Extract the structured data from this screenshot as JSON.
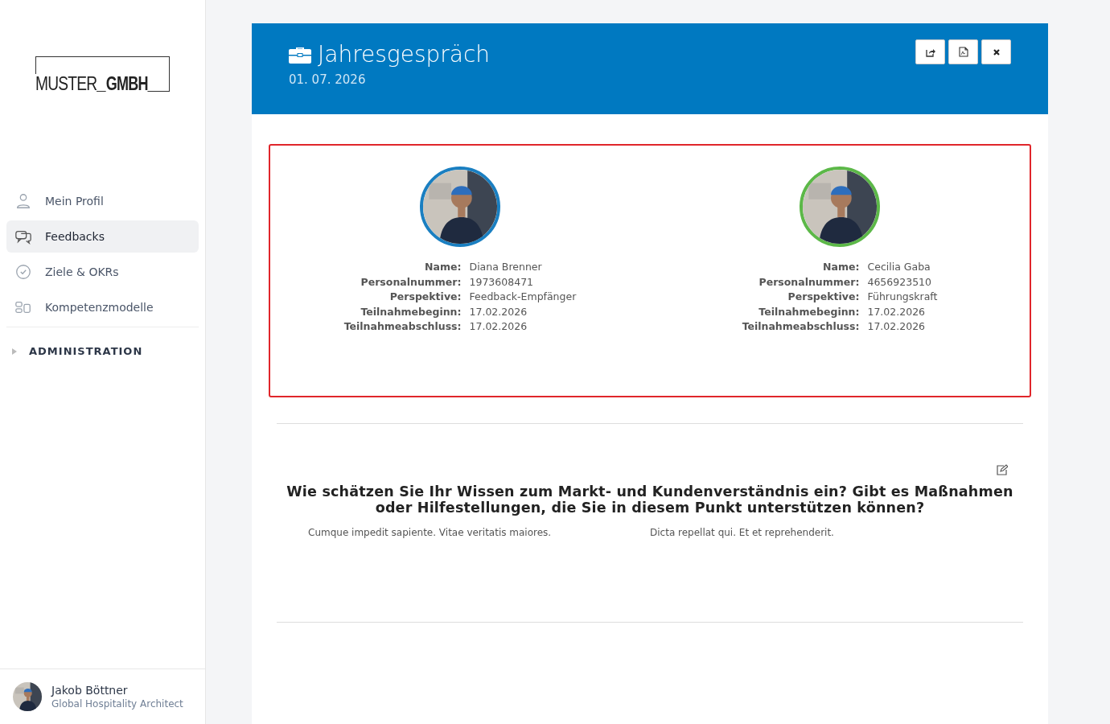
{
  "logo": {
    "light": "MUSTER",
    "bold": "GMBH"
  },
  "nav": [
    {
      "label": "Mein Profil",
      "kind": "person",
      "selected": false
    },
    {
      "label": "Feedbacks",
      "kind": "chat",
      "selected": true
    },
    {
      "label": "Ziele & OKRs",
      "kind": "check",
      "selected": false
    },
    {
      "label": "Kompetenzmodelle",
      "kind": "grid",
      "selected": false
    }
  ],
  "admin_section": {
    "label": "ADMINISTRATION",
    "expanded": false
  },
  "user": {
    "name": "Jakob Böttner",
    "role": "Global Hospitality Architect"
  },
  "header": {
    "title": "Jahresgespräch",
    "date": "01. 07. 2026",
    "actions": [
      {
        "kind": "share"
      },
      {
        "kind": "pdf"
      },
      {
        "kind": "close"
      }
    ]
  },
  "participants": [
    {
      "color": "#1a7fc1",
      "fields": [
        {
          "label": "Name:",
          "value": "Diana Brenner"
        },
        {
          "label": "Personalnummer:",
          "value": "1973608471"
        },
        {
          "label": "Perspektive:",
          "value": "Feedback-Empfänger"
        },
        {
          "label": "Teilnahmebeginn:",
          "value": "17.02.2026"
        },
        {
          "label": "Teilnahmeabschluss:",
          "value": "17.02.2026"
        }
      ]
    },
    {
      "color": "#5cb848",
      "fields": [
        {
          "label": "Name:",
          "value": "Cecilia Gaba"
        },
        {
          "label": "Personalnummer:",
          "value": "4656923510"
        },
        {
          "label": "Perspektive:",
          "value": "Führungskraft"
        },
        {
          "label": "Teilnahmebeginn:",
          "value": "17.02.2026"
        },
        {
          "label": "Teilnahmeabschluss:",
          "value": "17.02.2026"
        }
      ]
    }
  ],
  "question": {
    "text": "Wie schätzen Sie Ihr Wissen zum Markt- und Kundenverständnis ein? Gibt es Maßnahmen oder Hilfestellungen, die Sie in diesem Punkt unterstützen können?",
    "answers": [
      "Cumque impedit sapiente. Vitae veritatis maiores.",
      "Dicta repellat qui. Et et reprehenderit."
    ]
  }
}
